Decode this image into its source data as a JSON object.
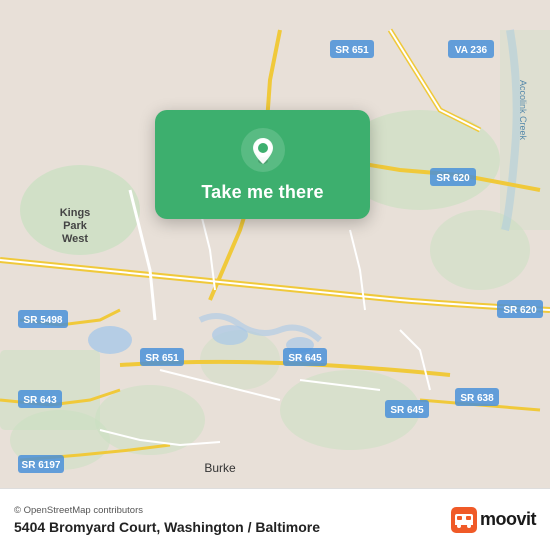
{
  "map": {
    "attribution": "© OpenStreetMap contributors",
    "address": "5404 Bromyard Court, Washington / Baltimore",
    "action_label": "Take me there",
    "moovit_label": "moovit",
    "colors": {
      "card_bg": "#3daf6e",
      "road_yellow": "#f0c93a",
      "road_white": "#ffffff",
      "map_bg": "#e8e0d8",
      "water": "#a8c8e8",
      "green": "#c8dfc0"
    },
    "road_labels": [
      "SR 620",
      "SR 651",
      "VA 236",
      "SR 5498",
      "SR 643",
      "SR 645",
      "SR 638",
      "SR 6197",
      "Kings Park West"
    ],
    "place_labels": [
      "Burke"
    ]
  }
}
